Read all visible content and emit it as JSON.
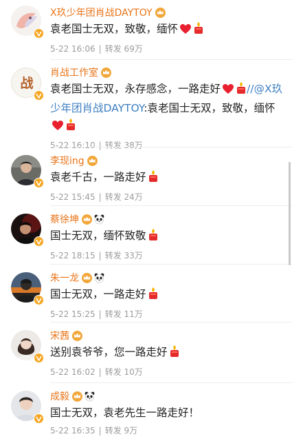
{
  "comments": [
    {
      "name": "X玖少年团肖战DAYTOY",
      "text": "袁老国士无双，致敬，缅怀",
      "emojis": [
        "heart",
        "candle"
      ],
      "time": "5-22 16:06",
      "repost_label": "转发",
      "reposts": "69万",
      "badges": [
        "crown"
      ],
      "avatar_icon": "fox-avatar"
    },
    {
      "name": "肖战工作室",
      "text": "袁老国士无双，永存感念，一路走好",
      "emojis": [
        "heart",
        "candle"
      ],
      "link_text": "//@X玖少年团肖战DAYTOY",
      "text2": ":袁老国士无双，致敬，缅怀",
      "emojis2": [
        "heart",
        "candle"
      ],
      "time": "5-22 16:10",
      "repost_label": "转发",
      "reposts": "38万",
      "badges": [
        "crown"
      ],
      "avatar_icon": "zhan-logo-avatar",
      "avatar_char": "战"
    },
    {
      "name": "李现ing",
      "text": "袁老千古，一路走好",
      "emojis": [
        "candle"
      ],
      "time": "5-22 15:45",
      "repost_label": "转发",
      "reposts": "24万",
      "badges": [
        "crown"
      ],
      "avatar_icon": "person-avatar"
    },
    {
      "name": "蔡徐坤",
      "text": "国士无双，缅怀致敬",
      "emojis": [
        "candle"
      ],
      "time": "5-22 18:15",
      "repost_label": "转发",
      "reposts": "33万",
      "badges": [
        "crown",
        "panda"
      ],
      "avatar_icon": "dark-person-avatar"
    },
    {
      "name": "朱一龙",
      "text": "国士无双，一路走好",
      "emojis": [
        "candle"
      ],
      "time": "5-22 15:25",
      "repost_label": "转发",
      "reposts": "11万",
      "badges": [
        "crown",
        "panda"
      ],
      "avatar_icon": "sunset-person-avatar"
    },
    {
      "name": "宋茜",
      "text": "送别袁爷爷，您一路走好",
      "emojis": [
        "candle"
      ],
      "time": "5-22 16:02",
      "repost_label": "转发",
      "reposts": "10万",
      "badges": [
        "crown"
      ],
      "avatar_icon": "woman-avatar"
    },
    {
      "name": "成毅",
      "text": "国士无双，袁老先生一路走好！",
      "emojis": [],
      "time": "5-22 16:35",
      "repost_label": "转发",
      "reposts": "9万",
      "badges": [
        "crown",
        "panda"
      ],
      "avatar_icon": "man-avatar"
    }
  ],
  "colors": {
    "name": "#e8741a",
    "link": "#3e7fc1",
    "meta": "#9b9b9b",
    "badge": "#f5a623"
  }
}
